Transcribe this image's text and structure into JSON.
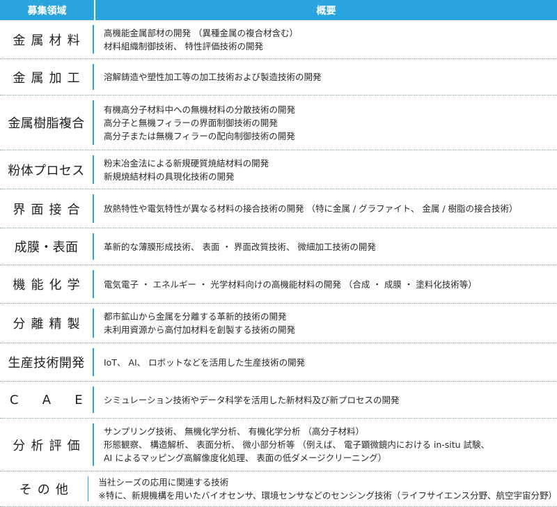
{
  "header": {
    "field_label": "募集領域",
    "desc_label": "概要"
  },
  "rows": [
    {
      "field": "金属材料",
      "style": "spaced",
      "lines": [
        "高機能金属部材の開発 （異種金属の複合材含む）",
        "材料組織制御技術、 特性評価技術の開発"
      ],
      "height": 56
    },
    {
      "field": "金属加工",
      "style": "spaced",
      "lines": [
        "溶解鋳造や塑性加工等の加工技術および製造技術の開発"
      ],
      "height": 52
    },
    {
      "field": "金属樹脂複合",
      "style": "normal",
      "lines": [
        "有機高分子材料中への無機材料の分散技術の開発",
        "高分子と無機フィラーの界面制御技術の開発",
        "高分子または無機フィラーの配向制御技術の開発"
      ],
      "height": 79
    },
    {
      "field": "粉体プロセス",
      "style": "normal",
      "lines": [
        "粉末冶金法による新規硬質焼結材料の開発",
        "新規焼結材料の具現化技術の開発"
      ],
      "height": 56
    },
    {
      "field": "界面接合",
      "style": "spaced",
      "lines": [
        "放熱特性や電気特性が異なる材料の接合技術の開発 （特に金属 / グラファイト、 金属 / 樹脂の接合技術）"
      ],
      "height": 56
    },
    {
      "field": "成膜・表面",
      "style": "normal",
      "lines": [
        "革新的な薄膜形成技術、 表面 ・ 界面改質技術、 微細加工技術の開発"
      ],
      "height": 53
    },
    {
      "field": "機能化学",
      "style": "spaced",
      "lines": [
        "電気電子 ・ エネルギー ・ 光学材料向けの高機能材料の開発 （合成 ・ 成膜 ・ 塗料化技術等）"
      ],
      "height": 55
    },
    {
      "field": "分離精製",
      "style": "spaced",
      "lines": [
        "都市鉱山から金属を分離する革新的技術の開発",
        "未利用資源から高付加材料を創製する技術の開発"
      ],
      "height": 57
    },
    {
      "field": "生産技術開発",
      "style": "normal",
      "lines": [
        "IoT、 AI、 ロボットなどを活用した生産技術の開発"
      ],
      "height": 55
    },
    {
      "field": "C A E",
      "style": "wide",
      "lines": [
        "シミュレーション技術やデータ科学を活用した新材料及び新プロセスの開発"
      ],
      "height": 53
    },
    {
      "field": "分析評価",
      "style": "spaced",
      "lines": [
        "サンプリング技術、 無機化学分析、 有機化学分析 （高分子材料）",
        "形態観察、 構造解析、 表面分析、 微小部分析等 （例えば、 電子顕微鏡内における in-situ 試験、",
        "AI によるマッピング高解像度化処理、 表面の低ダメージクリーニング）"
      ],
      "height": 76
    },
    {
      "field": "その他",
      "style": "spaced",
      "lines": [
        "当社シーズの応用に関連する技術",
        "※特に、新規機構を用いたバイオセンサ、環境センサなどのセンシング技術（ライフサイエンス分野、航空宇宙分野）"
      ],
      "height": 51
    }
  ]
}
